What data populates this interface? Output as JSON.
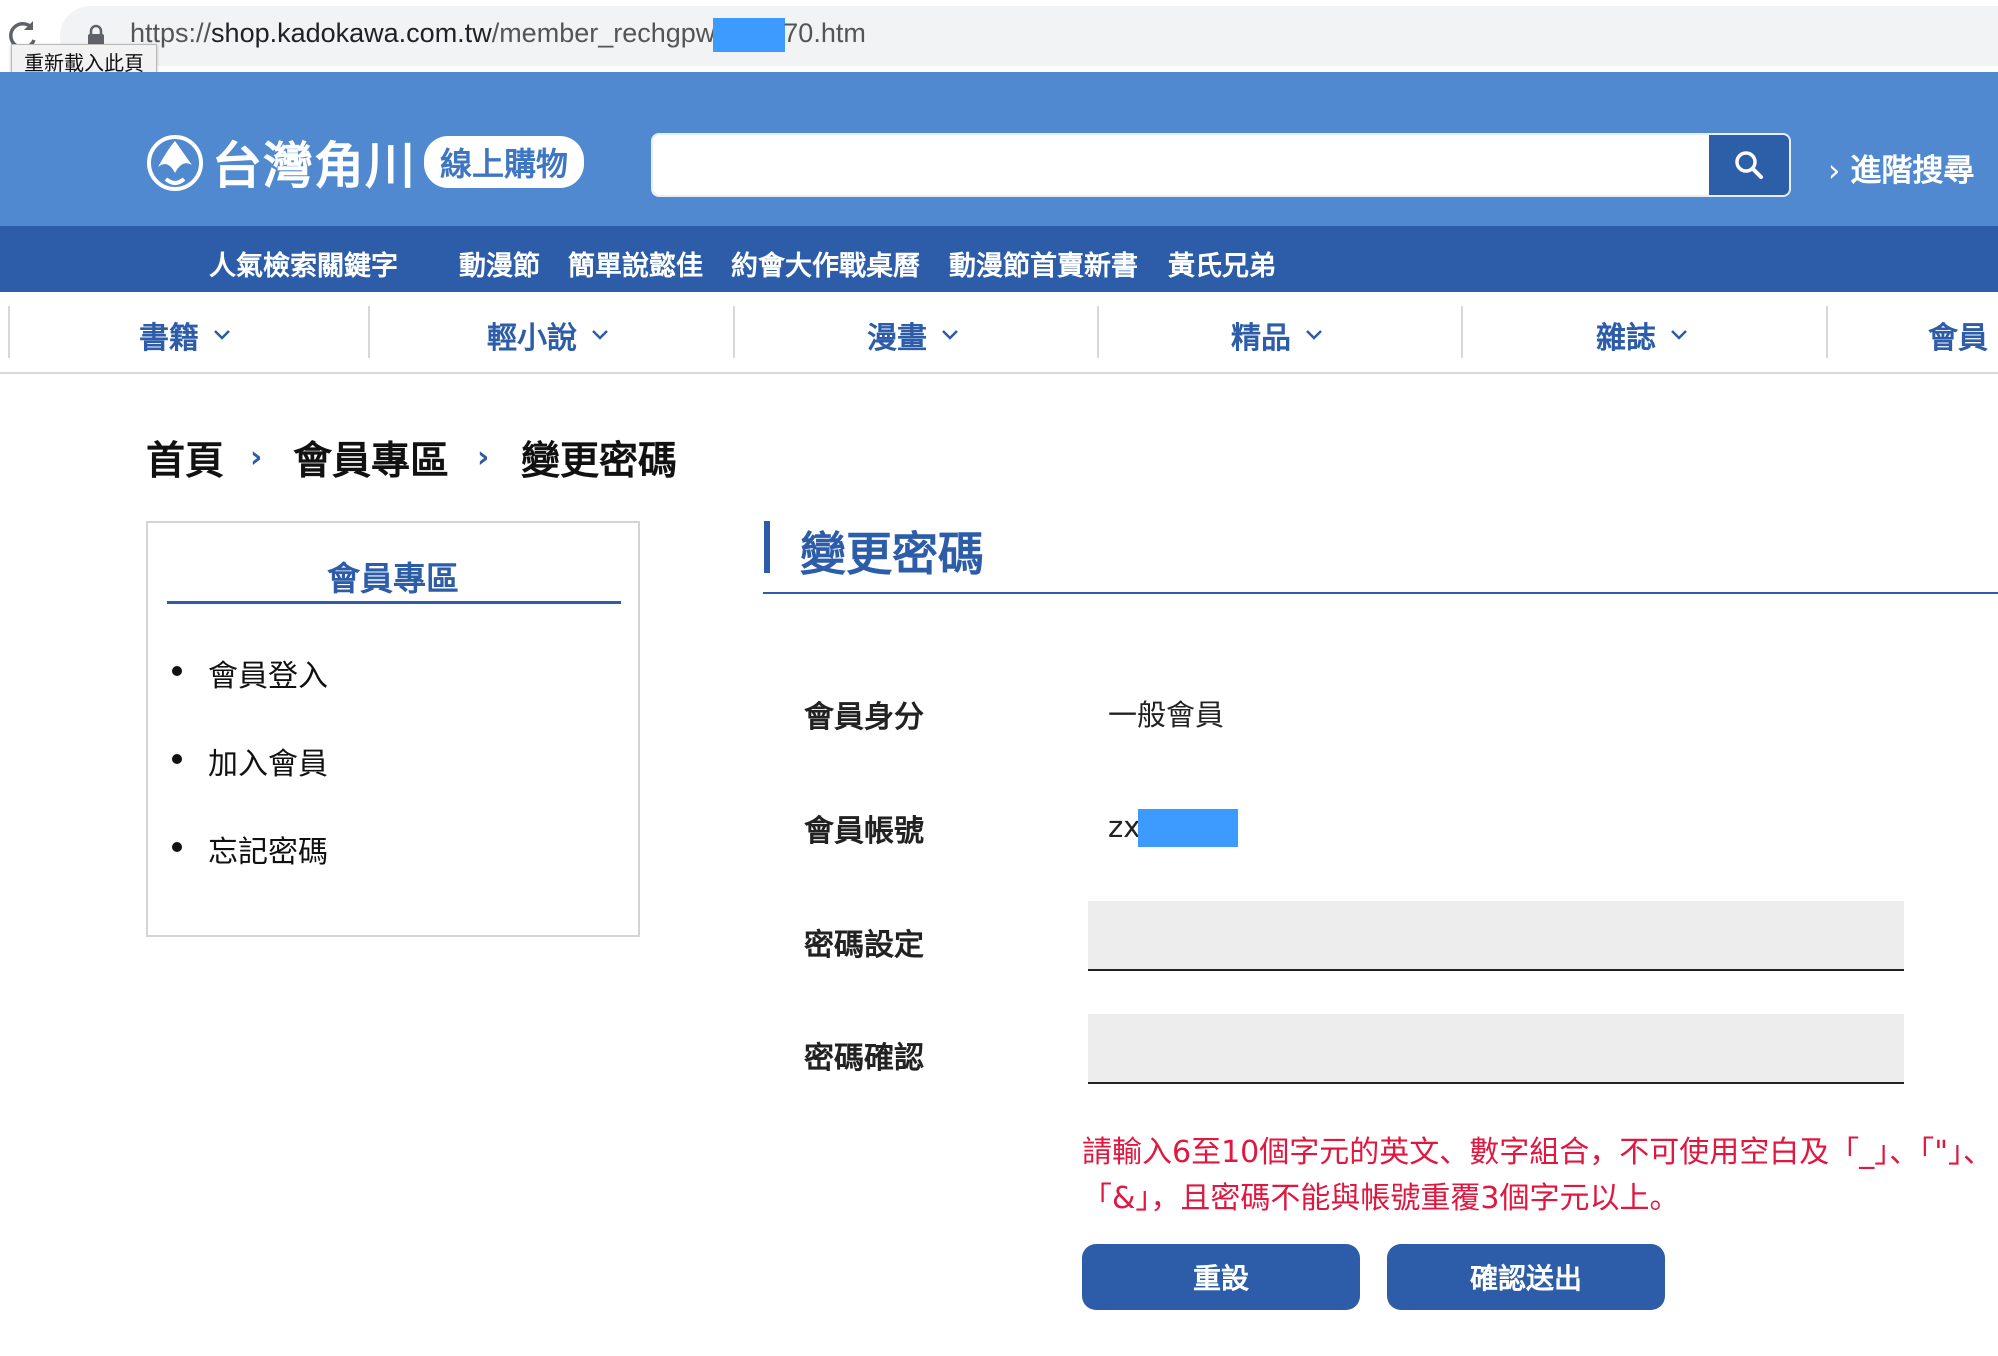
{
  "browser": {
    "url_prefix": "https://",
    "url_host": "shop.kadokawa.com.tw",
    "url_path_start": "/member_rechgpw",
    "url_path_end": "70.htm",
    "tooltip": "重新載入此頁"
  },
  "header": {
    "logo_text": "台灣角川",
    "logo_badge": "線上購物",
    "search_placeholder": "",
    "advanced_search": "進階搜尋"
  },
  "keywords": {
    "label": "人氣檢索關鍵字",
    "items": [
      "動漫節",
      "簡單說懿佳",
      "約會大作戰桌曆",
      "動漫節首賣新書",
      "黃氏兄弟"
    ]
  },
  "nav": {
    "items": [
      "書籍",
      "輕小說",
      "漫畫",
      "精品",
      "雜誌",
      "會員"
    ]
  },
  "breadcrumb": [
    "首頁",
    "會員專區",
    "變更密碼"
  ],
  "sidebar": {
    "title": "會員專區",
    "links": [
      "會員登入",
      "加入會員",
      "忘記密碼"
    ]
  },
  "main": {
    "title": "變更密碼",
    "member_type_label": "會員身分",
    "member_type_value": "一般會員",
    "account_label": "會員帳號",
    "account_value": "zx",
    "password_label": "密碼設定",
    "confirm_label": "密碼確認",
    "hint": "請輸入6至10個字元的英文、數字組合，不可使用空白及「_」、「\"」、「&」，且密碼不能與帳號重覆3個字元以上。",
    "reset_button": "重設",
    "submit_button": "確認送出"
  },
  "colors": {
    "header_blue": "#5089d0",
    "dark_blue": "#2d5ca8",
    "hint_red": "#e0173f"
  }
}
